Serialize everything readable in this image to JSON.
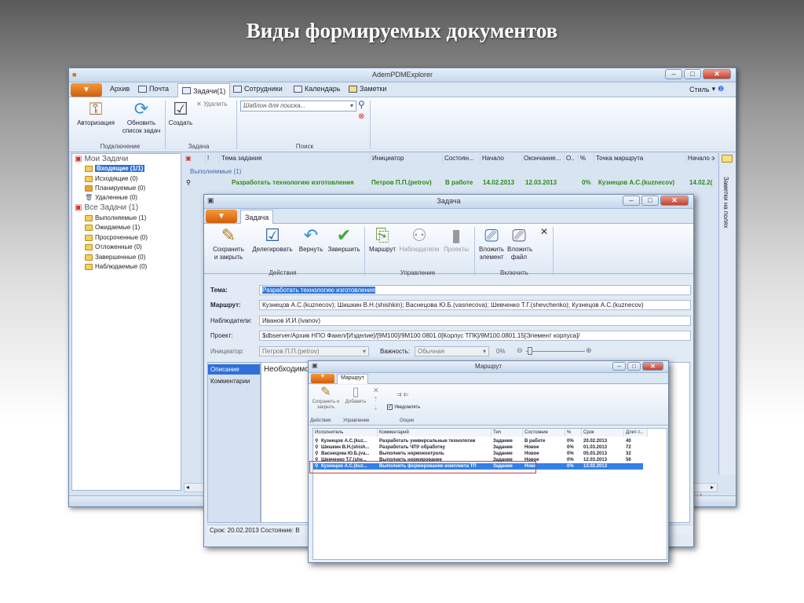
{
  "slide_title": "Виды формируемых документов",
  "main": {
    "title": "AdemPDMExplorer",
    "tabs": [
      {
        "label": "Архив"
      },
      {
        "label": "Почта"
      },
      {
        "label": "Задачи(1)"
      },
      {
        "label": "Сотрудники"
      },
      {
        "label": "Календарь"
      },
      {
        "label": "Заметки"
      }
    ],
    "style_label": "Стиль",
    "ribbon": {
      "auth": "Авторизация",
      "refresh": "Обновить список задач",
      "create": "Создать",
      "delete": "Удалить",
      "search_placeholder": "Шаблон для поиска...",
      "group_connect": "Подключение",
      "group_task": "Задача",
      "group_search": "Поиск"
    },
    "tree": {
      "my_tasks": "Мои Задачи",
      "inbox": "Входящие (1/1)",
      "outgoing": "Исходящие (0)",
      "planned": "Планируемые (0)",
      "deleted": "Удаленные (0)",
      "all_tasks": "Все Задачи (1)",
      "in_progress": "Выполняемые (1)",
      "waiting": "Ожидаемые (1)",
      "overdue": "Просроченные (0)",
      "postponed": "Отложенные (0)",
      "completed": "Завершенные (0)",
      "watched": "Наблюдаемые (0)"
    },
    "grid": {
      "headers": [
        "!",
        "Тема задания",
        "Инициатор",
        "Состоян...",
        "Начало",
        "Окончание...",
        "О..",
        "%",
        "Точка маршрута",
        "Начало э"
      ],
      "group": "Выполняемые (1)",
      "row": [
        "Разработать технологию изготовления",
        "Петров П.П.(petrov)",
        "В работе",
        "14.02.2013",
        "12.03.2013",
        "0%",
        "Кузнецов А.С.(kuznecov)",
        "14.02.2("
      ]
    },
    "side_label": "Заметки на полях",
    "status": "Срок: 20.02.2013   Состояние: В",
    "status_right": "v)"
  },
  "task": {
    "title": "Задача",
    "tab": "Задача",
    "buttons": {
      "save": "Сохранить и закрыть",
      "delegate": "Делегировать",
      "return": "Вернуть",
      "finish": "Завершить",
      "route": "Маршрут",
      "observers": "Наблюдатели",
      "projects": "Проекты",
      "attach_elem": "Вложить элемент",
      "attach_file": "Вложить файл"
    },
    "groups": {
      "actions": "Действия",
      "manage": "Управление",
      "include": "Включить"
    },
    "labels": {
      "subject": "Тема:",
      "route": "Маршрут:",
      "observers": "Наблюдатели:",
      "project": "Проект:",
      "initiator": "Инициатор:",
      "importance": "Важность:"
    },
    "values": {
      "subject": "Разработать технологию изготовления",
      "route": "Кузнецов А.С.(kuznecov); Шишкин В.Н.(shishkin); Васнецова Ю.Б.(vasnecova); Шевченко Т.Г.(shevchenko); Кузнецов А.С.(kuznecov)",
      "observers": "Иванов И.И.(ivanov)",
      "project": "$dbserver/Архив НПО Факел/[Изделие]/[9М100]/9М100.0801.0[Корпус ТПК]/9М100.0801.15[Элемент корпуса]/",
      "initiator": "Петров П.П.(petrov)",
      "importance": "Обычная",
      "progress": "0%"
    },
    "left_tabs": [
      "Описание",
      "Комментарии"
    ],
    "notes": "Необходимо р"
  },
  "route": {
    "title": "Маршрут",
    "tab": "Маршрут",
    "buttons": {
      "save": "Сохранить и закрыть",
      "add": "Добавить",
      "notify": "Уведомлять"
    },
    "groups": {
      "actions": "Действия",
      "manage": "Управление",
      "options": "Опции"
    },
    "headers": [
      "Исполнитель",
      "Комментарий",
      "Тип",
      "Состояние",
      "%",
      "Срок",
      "Длит-т..."
    ],
    "rows": [
      [
        "Кузнецов А.С.(kuz...",
        "Разработать универсальные технологии",
        "Задание",
        "В работе",
        "0%",
        "20.02.2013",
        "40"
      ],
      [
        "Шишкин В.Н.(shish...",
        "Разработать ЧПУ обработку",
        "Задание",
        "Новое",
        "0%",
        "01.03.2013",
        "72"
      ],
      [
        "Васнецова Ю.Б.(va...",
        "Выполнить нормоконтроль",
        "Задание",
        "Новое",
        "0%",
        "05.03.2013",
        "32"
      ],
      [
        "Шевченко Т.Г.(she...",
        "Выполнить нормирование",
        "Задание",
        "Новое",
        "0%",
        "12.03.2013",
        "56"
      ],
      [
        "Кузнецов А.С.(kuz...",
        "Выполнить формирование комплекта ТП",
        "Задание",
        "Ново",
        "0%",
        "13.02.2013",
        ""
      ]
    ]
  },
  "colors": {
    "accent_orange": "#e57018",
    "selection_blue": "#3380e6",
    "highlight_red": "#d23a3a",
    "task_green": "#2a8a16"
  }
}
